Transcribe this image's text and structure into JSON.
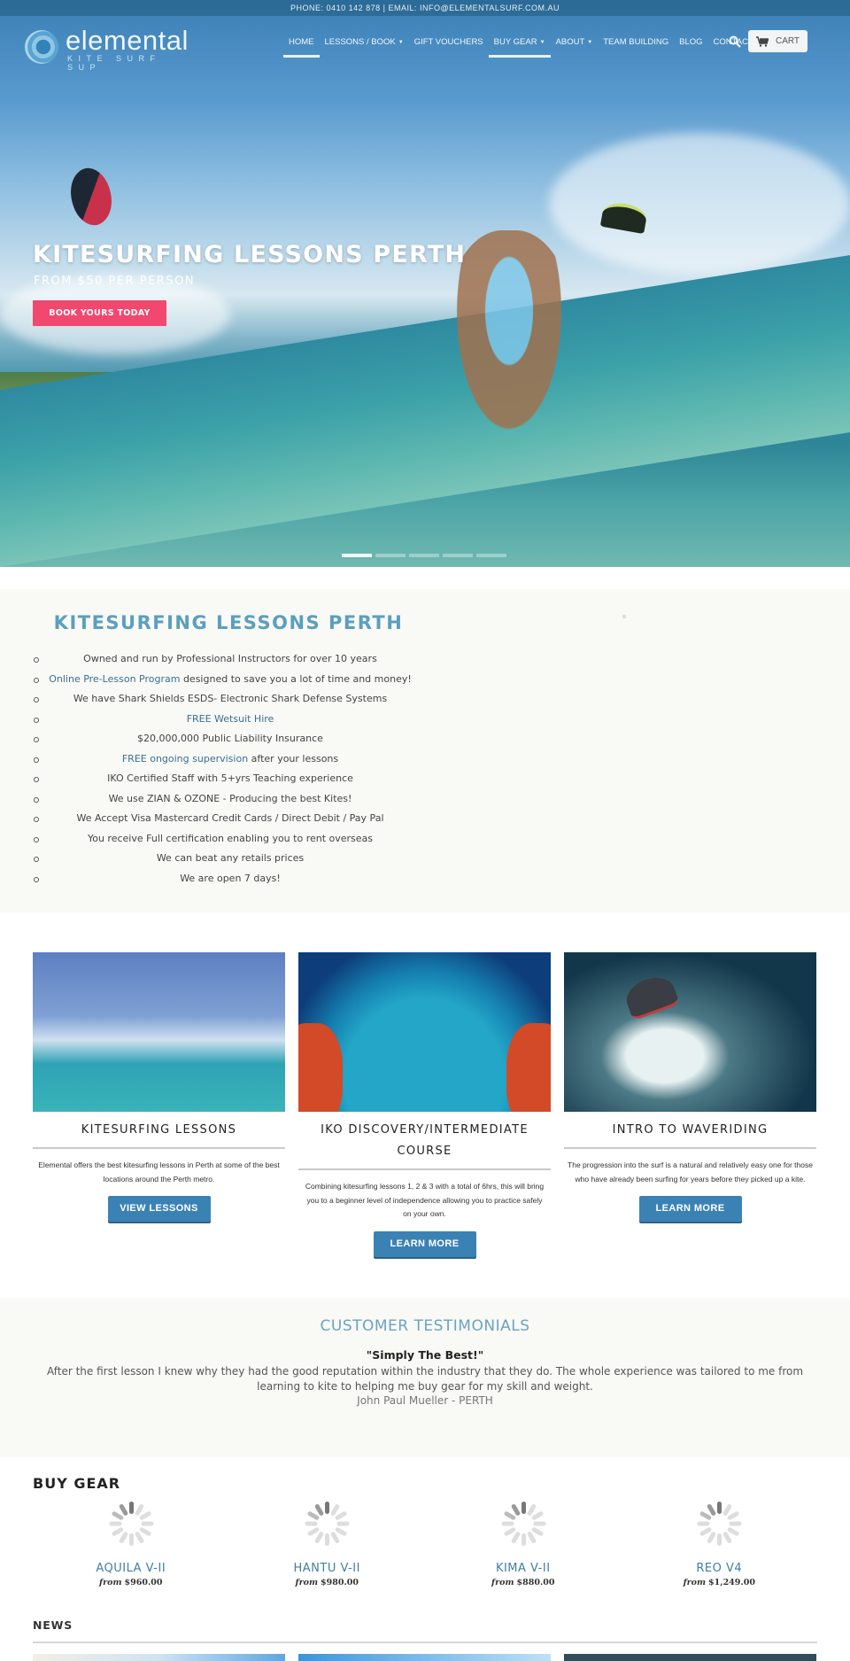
{
  "topbar": {
    "text": "PHONE: 0410 142 878 | EMAIL: INFO@ELEMENTALSURF.COM.AU"
  },
  "logo": {
    "name": "elemental",
    "tagline": "KITE SURF SUP"
  },
  "nav": {
    "items": [
      {
        "label": "HOME",
        "active": true,
        "dropdown": false
      },
      {
        "label": "LESSONS / BOOK",
        "active": false,
        "dropdown": true
      },
      {
        "label": "GIFT VOUCHERS",
        "active": false,
        "dropdown": false
      },
      {
        "label": "BUY GEAR",
        "active": true,
        "dropdown": true
      },
      {
        "label": "ABOUT",
        "active": false,
        "dropdown": true
      },
      {
        "label": "TEAM BUILDING",
        "active": false,
        "dropdown": false
      },
      {
        "label": "BLOG",
        "active": false,
        "dropdown": false
      },
      {
        "label": "CONTACT",
        "active": false,
        "dropdown": false
      }
    ],
    "caret": "▼",
    "search_icon": "search-icon",
    "cart_label": "CART",
    "cart_icon": "cart-icon"
  },
  "hero": {
    "title": "KITESURFING LESSONS PERTH",
    "subtitle": "FROM $50 PER PERSON",
    "button": "BOOK YOURS TODAY",
    "slides": 5,
    "active_slide": 1
  },
  "features": {
    "title": "KITESURFING LESSONS PERTH",
    "items": [
      {
        "link": "",
        "text": "Owned and run by Professional Instructors for over 10 years"
      },
      {
        "link": "Online Pre-Lesson Program",
        "text": " designed to save you a lot of time and money!"
      },
      {
        "link": "",
        "text": "We have Shark Shields ESDS- Electronic Shark Defense Systems"
      },
      {
        "link": "FREE Wetsuit Hire",
        "text": ""
      },
      {
        "link": "",
        "text": "$20,000,000 Public Liability Insurance"
      },
      {
        "link": "FREE ongoing supervision",
        "text": " after your lessons"
      },
      {
        "link": "",
        "text": "IKO Certified Staff with 5+yrs Teaching experience"
      },
      {
        "link": "",
        "text": "We use ZIAN & OZONE - Producing the best Kites!"
      },
      {
        "link": "",
        "text": "We Accept Visa Mastercard Credit Cards / Direct Debit / Pay Pal"
      },
      {
        "link": "",
        "text": "You receive Full certification enabling you to rent overseas"
      },
      {
        "link": "",
        "text": "We can beat any retails prices"
      },
      {
        "link": "",
        "text": "We are open 7 days!"
      }
    ]
  },
  "cards": [
    {
      "title": "KITESURFING LESSONS",
      "text": "Elemental offers the best kitesurfing lessons in Perth at some of the best locations around the Perth metro.",
      "button": "VIEW LESSONS"
    },
    {
      "title": "IKO DISCOVERY/INTERMEDIATE COURSE",
      "text": "Combining kitesurfing lessons 1, 2 & 3 with a total of 6hrs, this will bring you to a beginner level of independence allowing you to practice safely on your own.",
      "button": "LEARN MORE"
    },
    {
      "title": "INTRO TO WAVERIDING",
      "text": "The progression into the surf is a natural and relatively easy one for those who have already been surfing for years before they picked up a kite.",
      "button": "LEARN MORE"
    }
  ],
  "testimonials": {
    "title": "CUSTOMER TESTIMONIALS",
    "quote_title": "\"Simply The Best!\"",
    "quote": "After the first lesson I knew why they had the good reputation within the industry that they do. The whole experience was tailored to me from learning to kite to helping me buy gear for my skill and weight.",
    "author": "John Paul Mueller - PERTH"
  },
  "buy_gear": {
    "title": "BUY GEAR",
    "products": [
      {
        "name": "AQUILA V-II",
        "from": "from",
        "price": "$960.00"
      },
      {
        "name": "HANTU V-II",
        "from": "from",
        "price": "$980.00"
      },
      {
        "name": "KIMA V-II",
        "from": "from",
        "price": "$880.00"
      },
      {
        "name": "REO V4",
        "from": "from",
        "price": "$1,249.00"
      }
    ]
  },
  "news": {
    "title": "NEWS"
  },
  "colors": {
    "accent_pink": "#f2476f",
    "button_blue": "#3b82b4",
    "heading_blue": "#5b9fbf",
    "link_blue": "#3a6f94"
  }
}
